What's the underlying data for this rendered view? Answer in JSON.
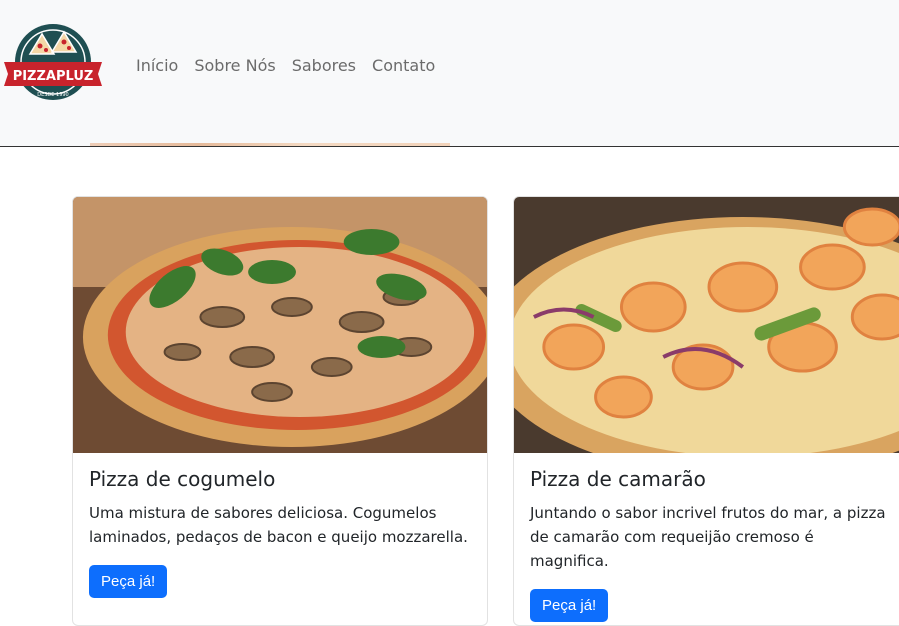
{
  "nav": {
    "logo_text": "PIZZAPLUZ",
    "logo_since": "DESDE 1990",
    "links": [
      "Início",
      "Sobre Nós",
      "Sabores",
      "Contato"
    ]
  },
  "cards": [
    {
      "title": "Pizza de cogumelo",
      "text": "Uma mistura de sabores deliciosa. Cogumelos laminados, pedaços de bacon e queijo mozzarella.",
      "button": "Peça já!"
    },
    {
      "title": "Pizza de camarão",
      "text": "Juntando o sabor incrivel frutos do mar, a pizza de camarão com requeijão cremoso é magnifica.",
      "button": "Peça já!"
    }
  ],
  "colors": {
    "primary": "#0d6efd",
    "navbar_bg": "#f8f9fa",
    "logo_teal": "#1f4f52",
    "logo_red": "#c8232c"
  }
}
